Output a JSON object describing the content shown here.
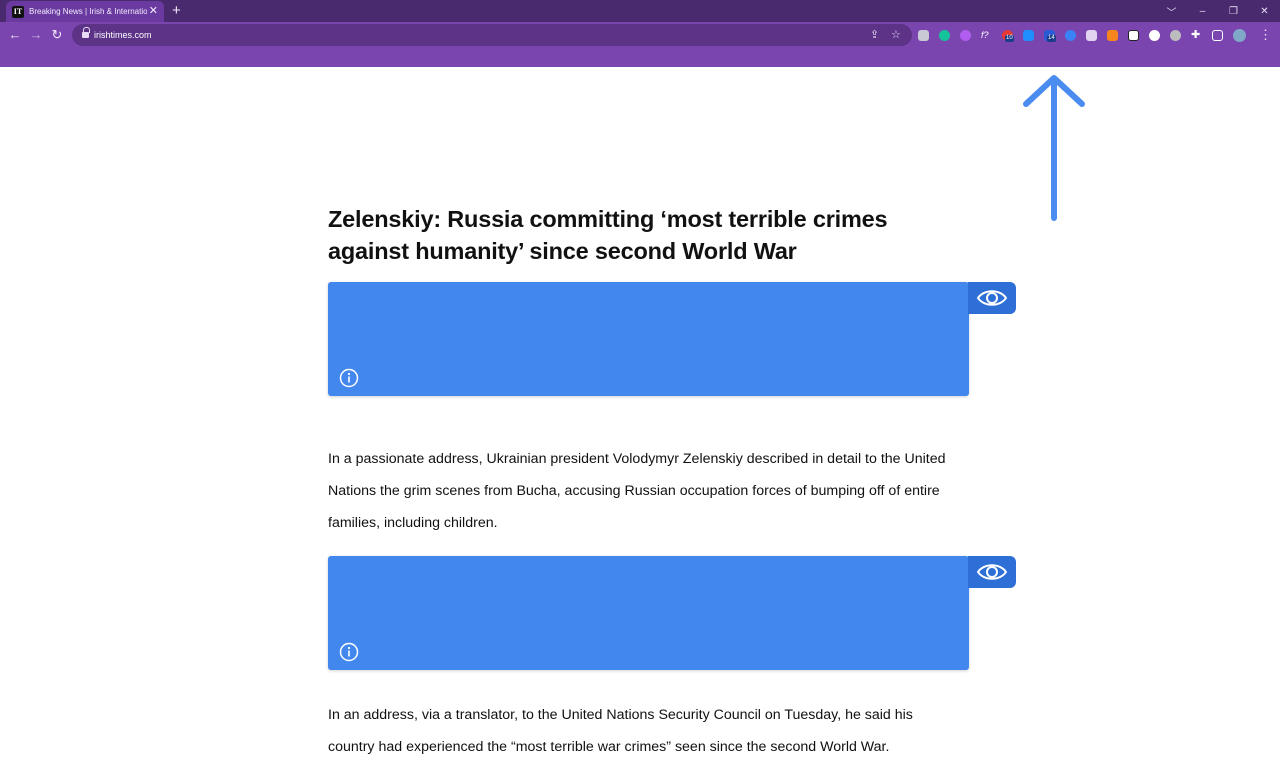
{
  "browser": {
    "tab_title": "Breaking News | Irish & International",
    "favicon_text": "IT",
    "new_tab": "+",
    "close_tab": "✕",
    "url": "irishtimes.com",
    "window_controls": [
      "﹀",
      "–",
      "❐",
      "✕"
    ],
    "extension_badges": {
      "ext_10": "10",
      "ext_14": "14"
    },
    "accent_color": "#7b45b0"
  },
  "article": {
    "headline": "Zelenskiy: Russia committing ‘most terrible crimes against humanity’ since second World War",
    "paragraphs": [
      "In a passionate address, Ukrainian president Volodymyr Zelenskiy described in detail to the United Nations the grim scenes from Bucha, accusing Russian occupation forces of bumping off of entire families, including children.",
      "In an address, via a translator, to the United Nations Security Council on Tuesday, he said his country had experienced the “most terrible war crimes” seen since the second World War."
    ]
  },
  "overlays": {
    "block_color": "#4287ee",
    "eye_tab_color": "#2d6fd6",
    "arrow_color": "#4a8cf0"
  }
}
